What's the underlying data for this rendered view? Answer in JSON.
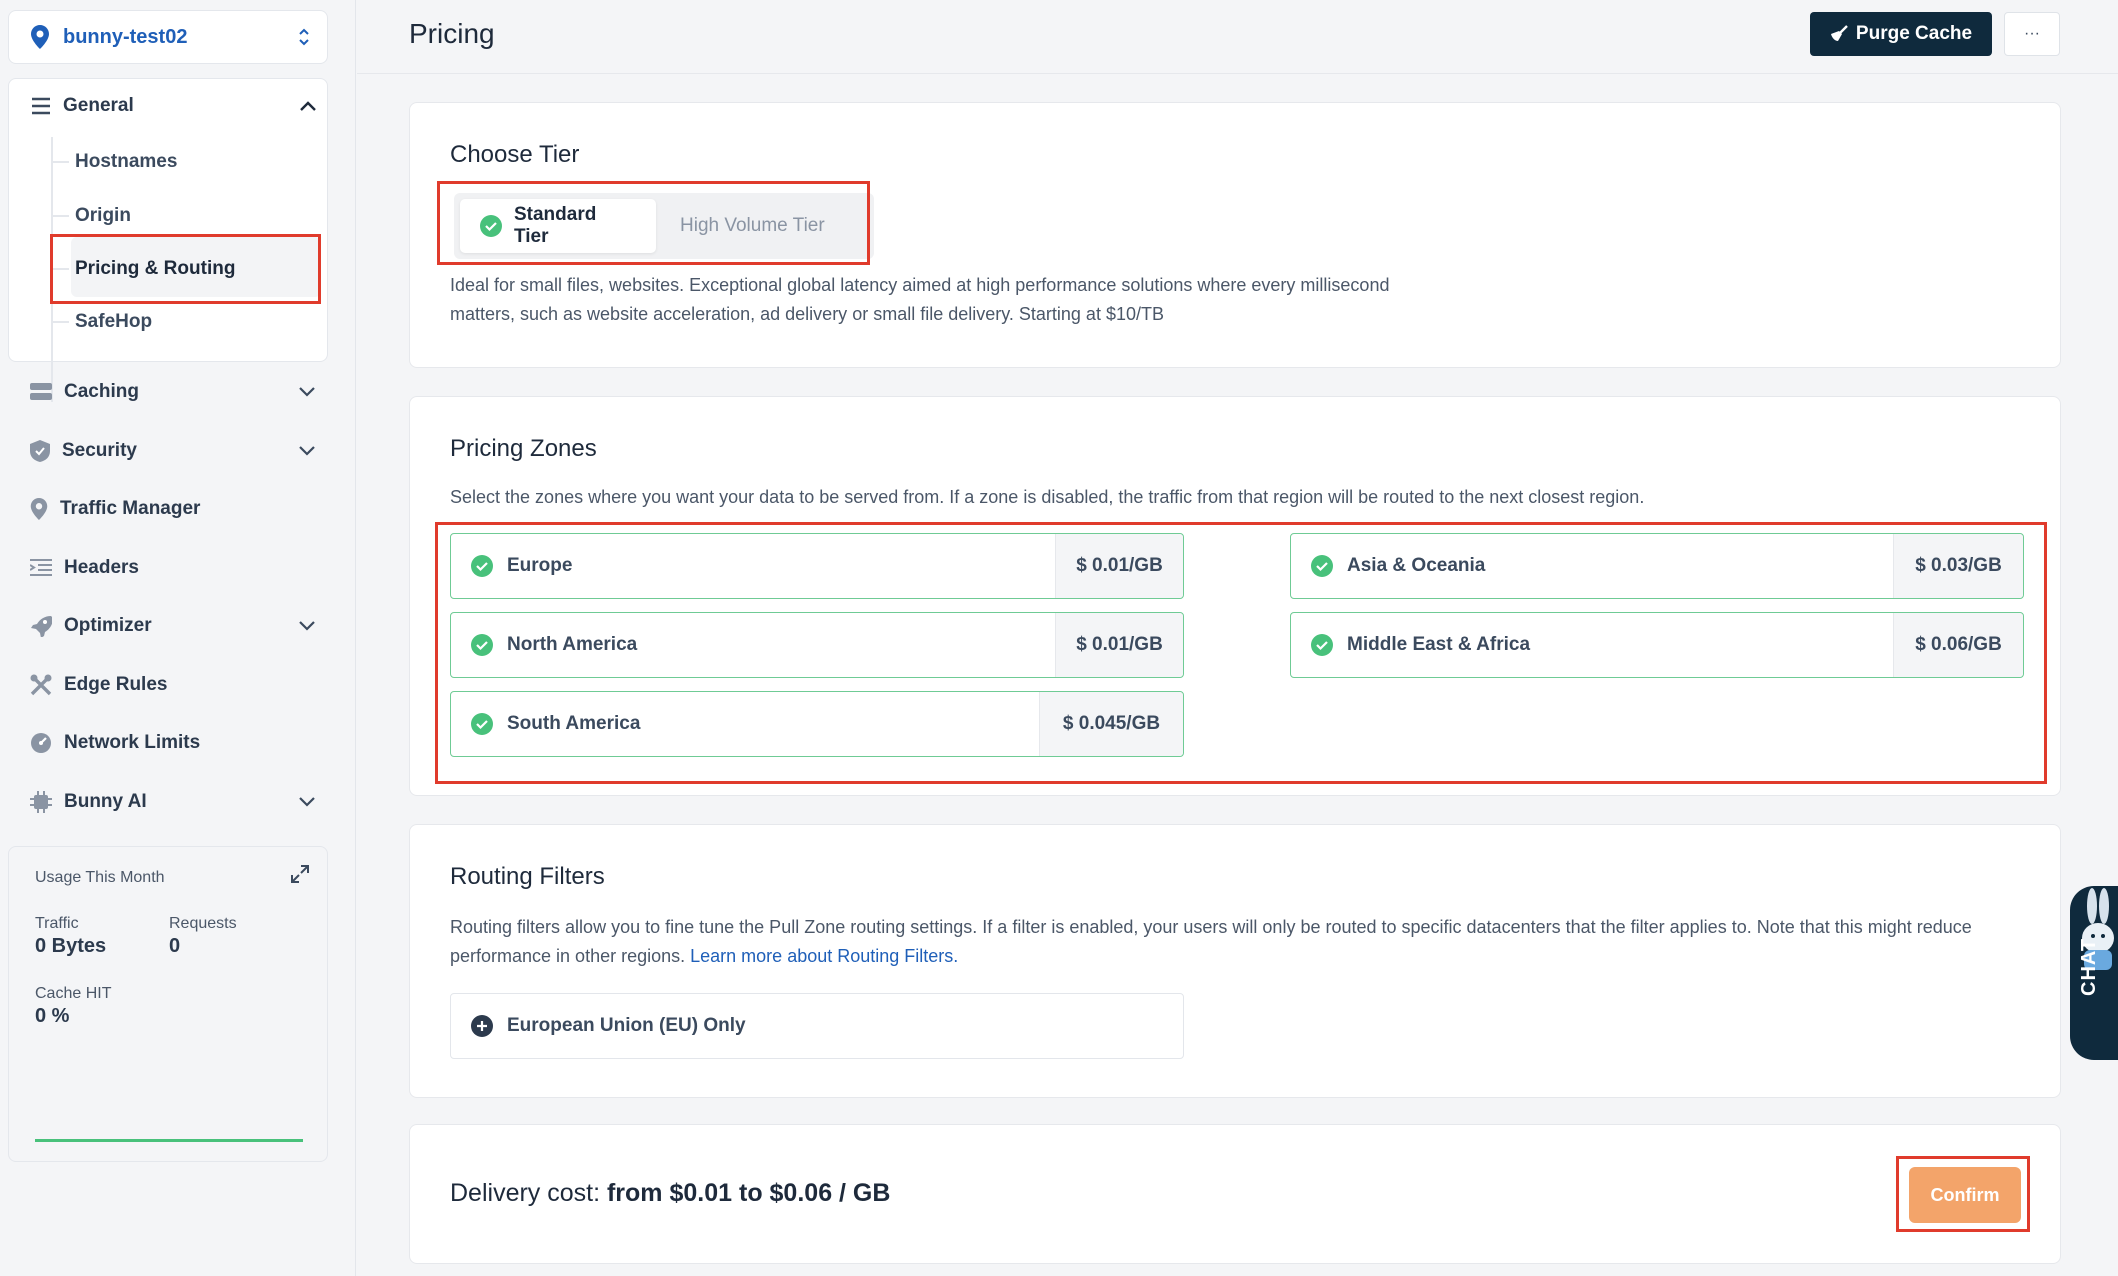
{
  "sidebar": {
    "zone_name": "bunny-test02",
    "general": {
      "label": "General",
      "items": [
        "Hostnames",
        "Origin",
        "Pricing & Routing",
        "SafeHop"
      ],
      "active": "Pricing & Routing"
    },
    "items": [
      {
        "label": "Caching",
        "icon": "server-icon",
        "expandable": true
      },
      {
        "label": "Security",
        "icon": "shield-icon",
        "expandable": true
      },
      {
        "label": "Traffic Manager",
        "icon": "map-pin-icon",
        "expandable": false
      },
      {
        "label": "Headers",
        "icon": "list-icon",
        "expandable": false
      },
      {
        "label": "Optimizer",
        "icon": "rocket-icon",
        "expandable": true
      },
      {
        "label": "Edge Rules",
        "icon": "tools-icon",
        "expandable": false
      },
      {
        "label": "Network Limits",
        "icon": "gauge-icon",
        "expandable": false
      },
      {
        "label": "Bunny AI",
        "icon": "chip-icon",
        "expandable": true
      }
    ],
    "usage": {
      "title": "Usage This Month",
      "traffic_label": "Traffic",
      "traffic_value": "0 Bytes",
      "requests_label": "Requests",
      "requests_value": "0",
      "cache_hit_label": "Cache HIT",
      "cache_hit_value": "0 %"
    }
  },
  "header": {
    "title": "Pricing",
    "purge_label": "Purge Cache",
    "more_label": "···"
  },
  "tier": {
    "title": "Choose Tier",
    "options": [
      "Standard Tier",
      "High Volume Tier"
    ],
    "selected": "Standard Tier",
    "description": "Ideal for small files, websites. Exceptional global latency aimed at high performance solutions where every millisecond matters, such as website acceleration, ad delivery or small file delivery. Starting at $10/TB"
  },
  "zones": {
    "title": "Pricing Zones",
    "description": "Select the zones where you want your data to be served from. If a zone is disabled, the traffic from that region will be routed to the next closest region.",
    "items": [
      {
        "name": "Europe",
        "price": "$ 0.01/GB",
        "enabled": true
      },
      {
        "name": "North America",
        "price": "$ 0.01/GB",
        "enabled": true
      },
      {
        "name": "South America",
        "price": "$ 0.045/GB",
        "enabled": true
      },
      {
        "name": "Asia & Oceania",
        "price": "$ 0.03/GB",
        "enabled": true
      },
      {
        "name": "Middle East & Africa",
        "price": "$ 0.06/GB",
        "enabled": true
      }
    ]
  },
  "routing": {
    "title": "Routing Filters",
    "description": "Routing filters allow you to fine tune the Pull Zone routing settings. If a filter is enabled, your users will only be routed to specific datacenters that the filter applies to. Note that this might reduce performance in other regions. ",
    "link_label": "Learn more about Routing Filters.",
    "filter_label": "European Union (EU) Only"
  },
  "footer": {
    "cost_label": "Delivery cost: ",
    "cost_value": "from $0.01 to $0.06 / GB",
    "confirm_label": "Confirm"
  },
  "chat": {
    "label": "CHAT"
  },
  "colors": {
    "accent": "#1f5fb8",
    "dark_button": "#0f2a3d",
    "confirm": "#f3a46a",
    "zone_border": "#6fcb95",
    "check": "#48c17b",
    "highlight": "#e03b2c"
  }
}
